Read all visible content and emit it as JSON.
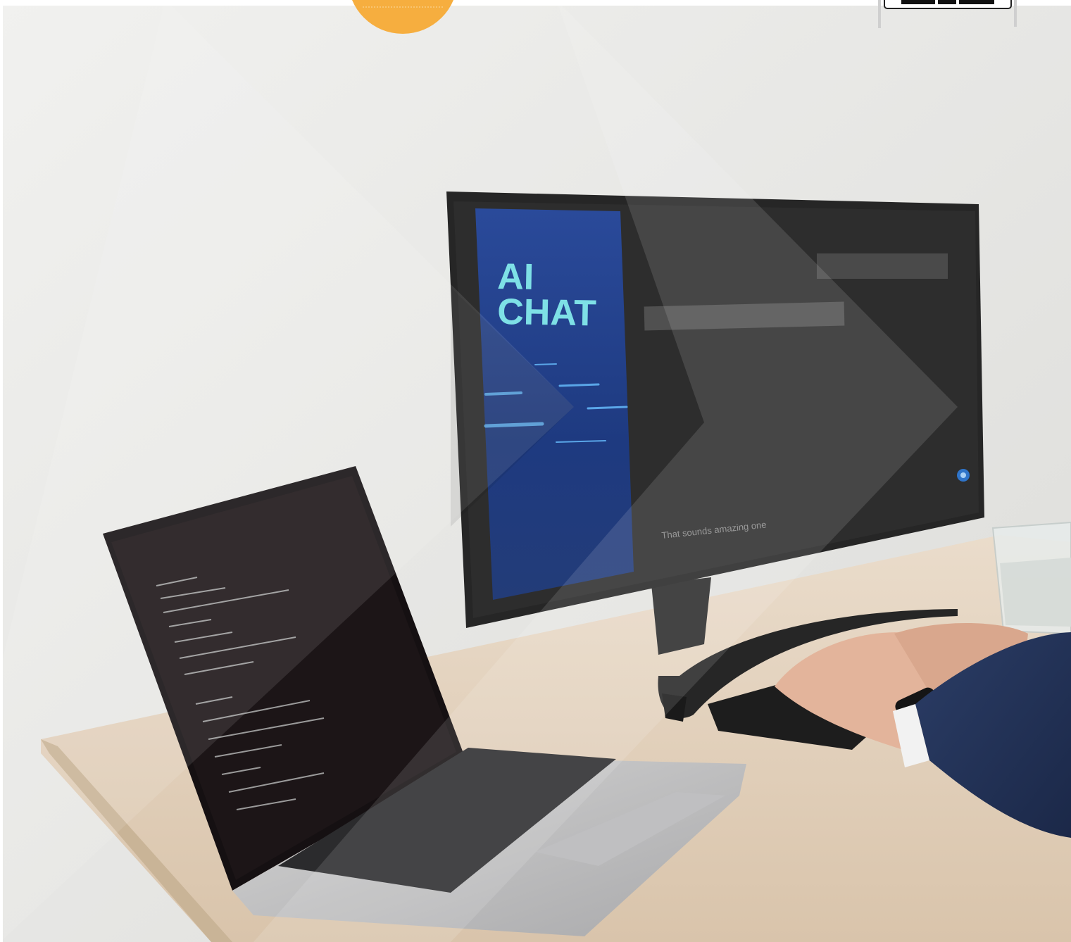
{
  "monitor_screen": {
    "brand_title_line1": "AI",
    "brand_title_line2": "CHAT",
    "reply_text": "That sounds amazing one"
  },
  "colors": {
    "wall": "#e9e9e7",
    "accent_orange": "#f6ae3f",
    "chat_panel_blue": "#1f3f8c",
    "chat_text_cyan": "#7ee0e6",
    "monitor_screen": "#232323",
    "desk": "#e3d3bf"
  }
}
